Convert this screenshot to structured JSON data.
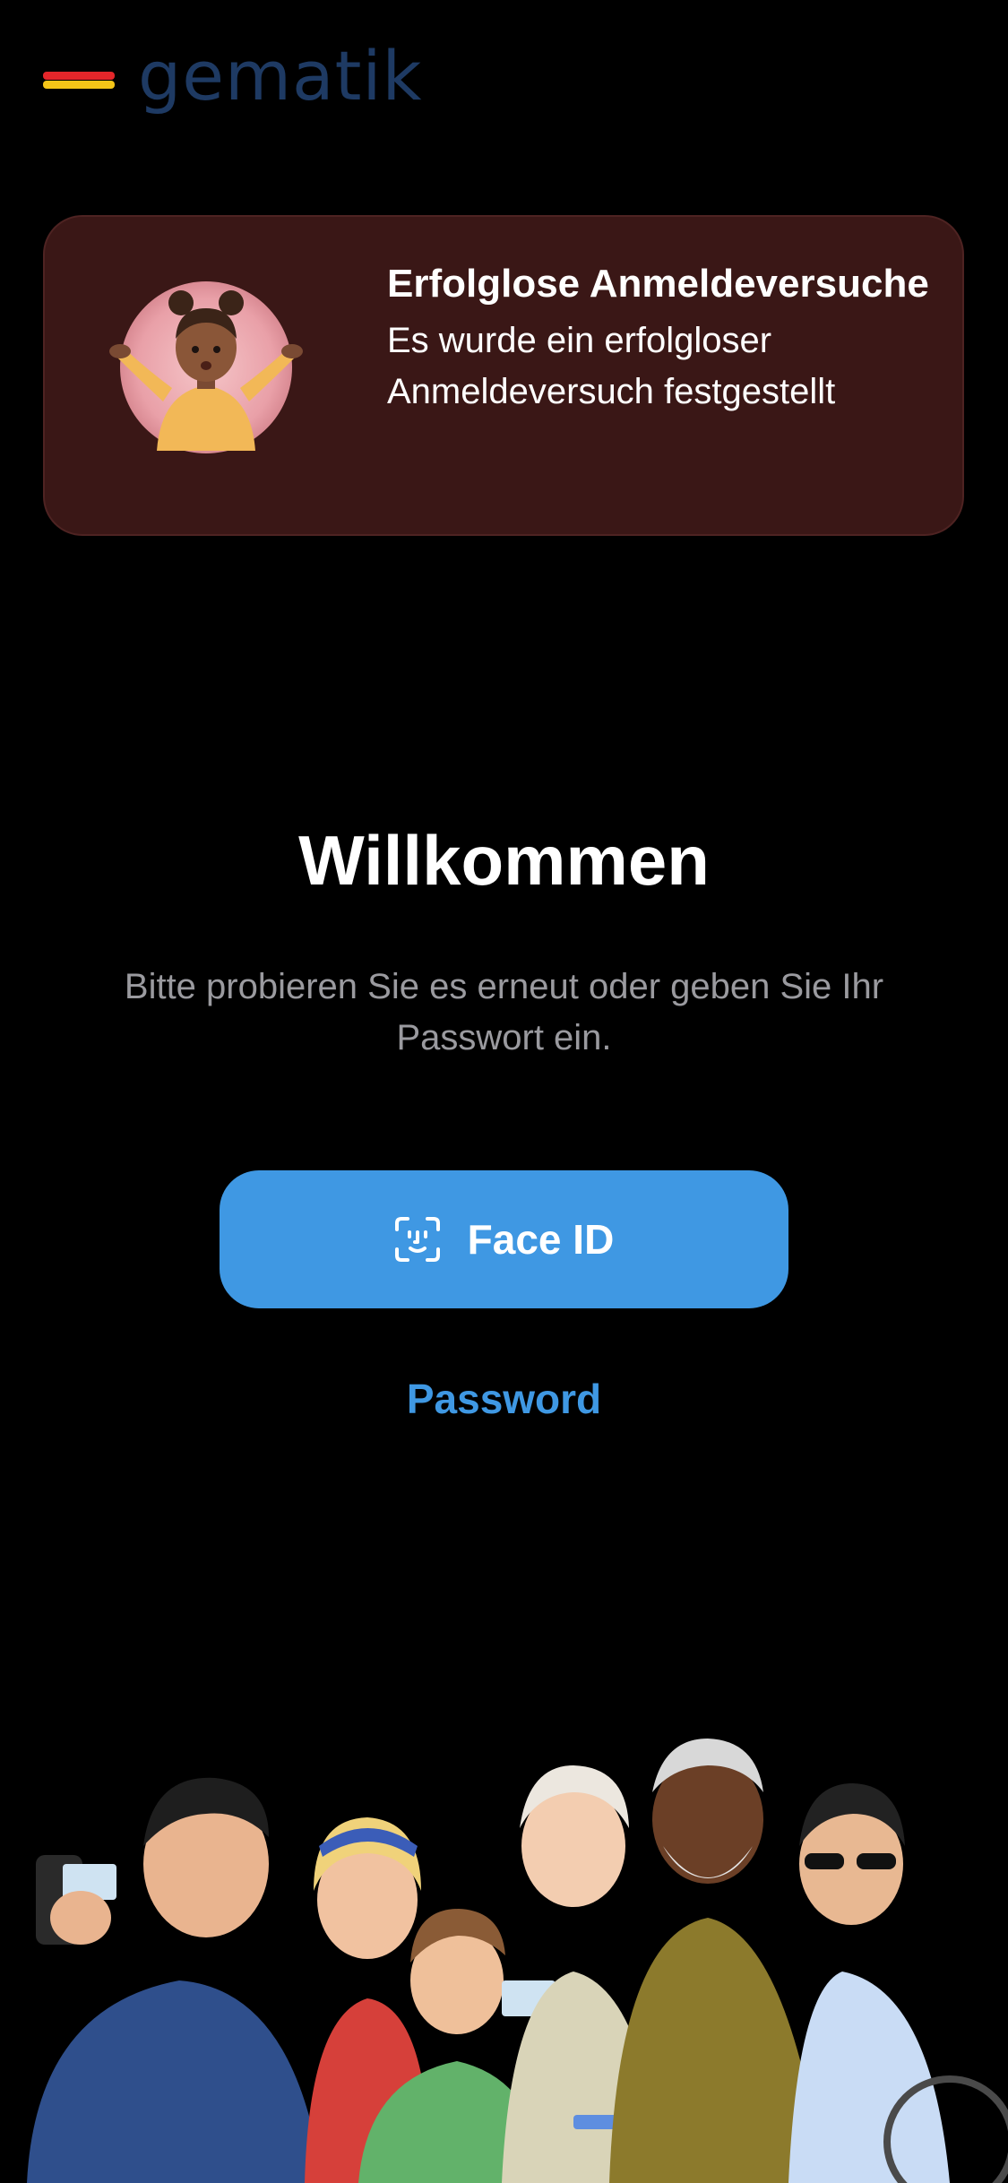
{
  "brand": {
    "logo_text": "gematik",
    "flag_colors": [
      "#000000",
      "#e4262a",
      "#f4c518"
    ],
    "logo_color": "#1e3a63"
  },
  "alert": {
    "title": "Erfolglose Anmeldeversuche",
    "body": "Es wurde ein erfolgloser Anmeldeversuch festgestellt",
    "avatar_icon": "shrugging-person-avatar",
    "background_color": "#3a1716"
  },
  "welcome": {
    "title": "Willkommen",
    "subtitle": "Bitte probieren Sie es erneut oder geben Sie Ihr Passwort ein."
  },
  "actions": {
    "faceid_label": "Face ID",
    "faceid_icon": "face-id-icon",
    "password_label": "Password",
    "accent_color": "#3f98e3"
  },
  "illustration": {
    "icon": "group-of-people-illustration"
  }
}
